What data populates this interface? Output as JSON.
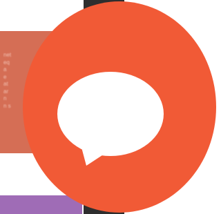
{
  "background": {
    "card_text": "net\neq\na\ne\nat\nar\nn\nn s",
    "colors": {
      "card": "#d56e55",
      "strip": "#2e2e2e",
      "bar": "#9f6cb6"
    }
  },
  "chat_button": {
    "icon": "speech-bubble-icon",
    "colors": {
      "ring": "#f15a36",
      "bubble": "#ffffff"
    }
  }
}
